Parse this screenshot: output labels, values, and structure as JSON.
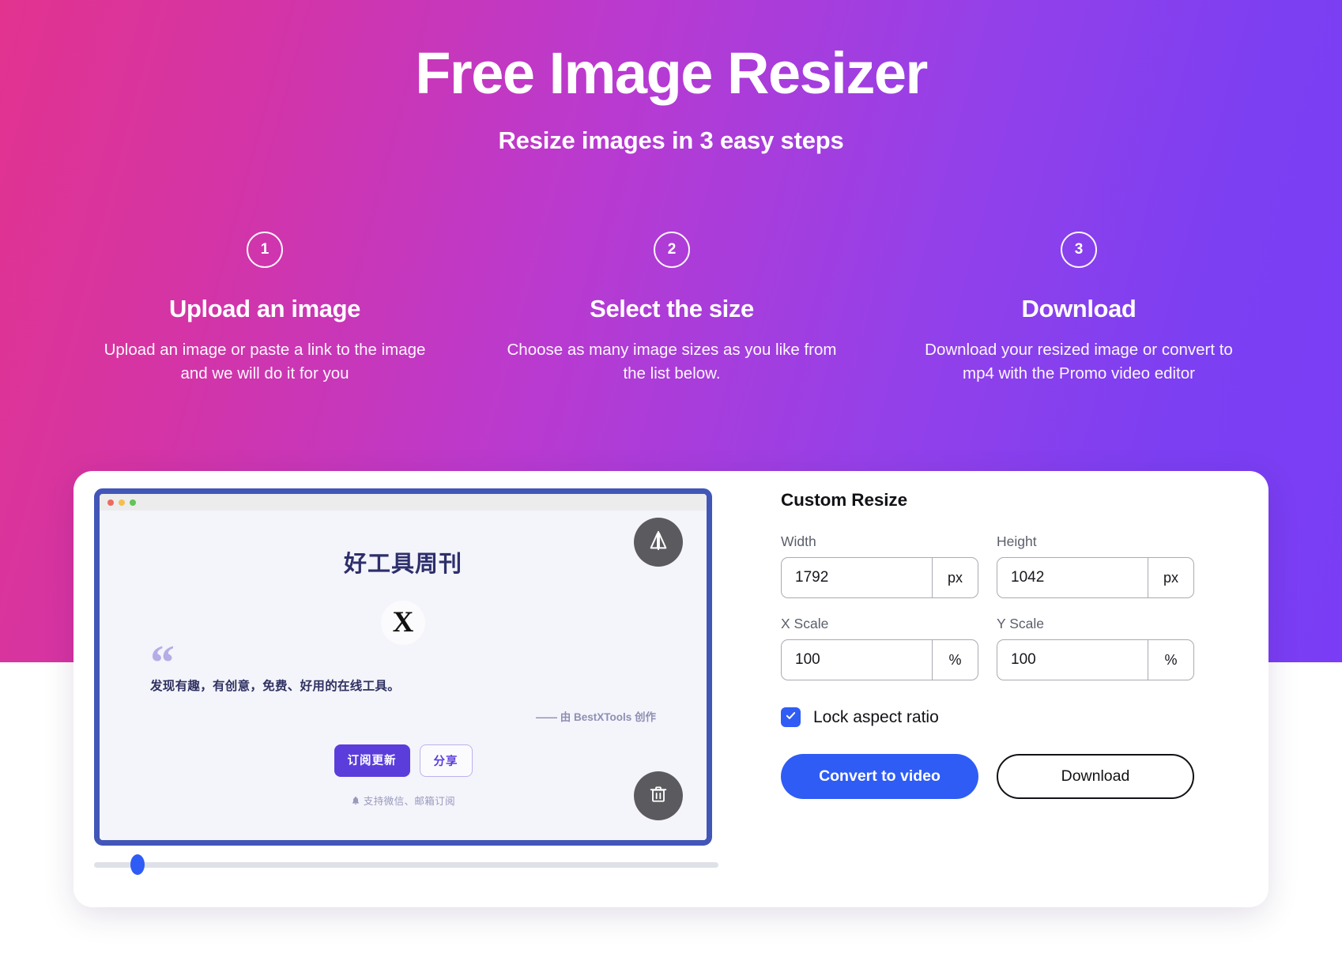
{
  "hero": {
    "title": "Free Image Resizer",
    "subtitle": "Resize images in 3 easy steps"
  },
  "steps": [
    {
      "number": "1",
      "title": "Upload an image",
      "description": "Upload an image or paste a link to the image and we will do it for you"
    },
    {
      "number": "2",
      "title": "Select the size",
      "description": "Choose as many image sizes as you like from the list below."
    },
    {
      "number": "3",
      "title": "Download",
      "description": "Download your resized image or convert to mp4 with the Promo video editor"
    }
  ],
  "preview": {
    "newsletter": {
      "title": "好工具周刊",
      "logo_letter": "X",
      "quote_mark": "“",
      "quote": "发现有趣，有创意，免费、好用的在线工具。",
      "author": "—— 由 BestXTools 创作",
      "subscribe_label": "订阅更新",
      "share_label": "分享",
      "footer": "支持微信、邮箱订阅"
    },
    "flip_button_name": "flip-horizontal-icon",
    "delete_button_name": "trash-icon",
    "slider_position_percent": 7
  },
  "controls": {
    "section_title": "Custom Resize",
    "fields": [
      {
        "label": "Width",
        "value": "1792",
        "unit": "px"
      },
      {
        "label": "Height",
        "value": "1042",
        "unit": "px"
      },
      {
        "label": "X Scale",
        "value": "100",
        "unit": "%"
      },
      {
        "label": "Y Scale",
        "value": "100",
        "unit": "%"
      }
    ],
    "lock_aspect_ratio": {
      "label": "Lock aspect ratio",
      "checked": true
    },
    "primary_button": "Convert to video",
    "secondary_button": "Download"
  },
  "colors": {
    "gradient_start": "#e2338f",
    "gradient_end": "#7a3df5",
    "accent_blue": "#2f5cf5",
    "browser_frame": "#4256b8",
    "newsletter_purple": "#5b3ddb"
  }
}
